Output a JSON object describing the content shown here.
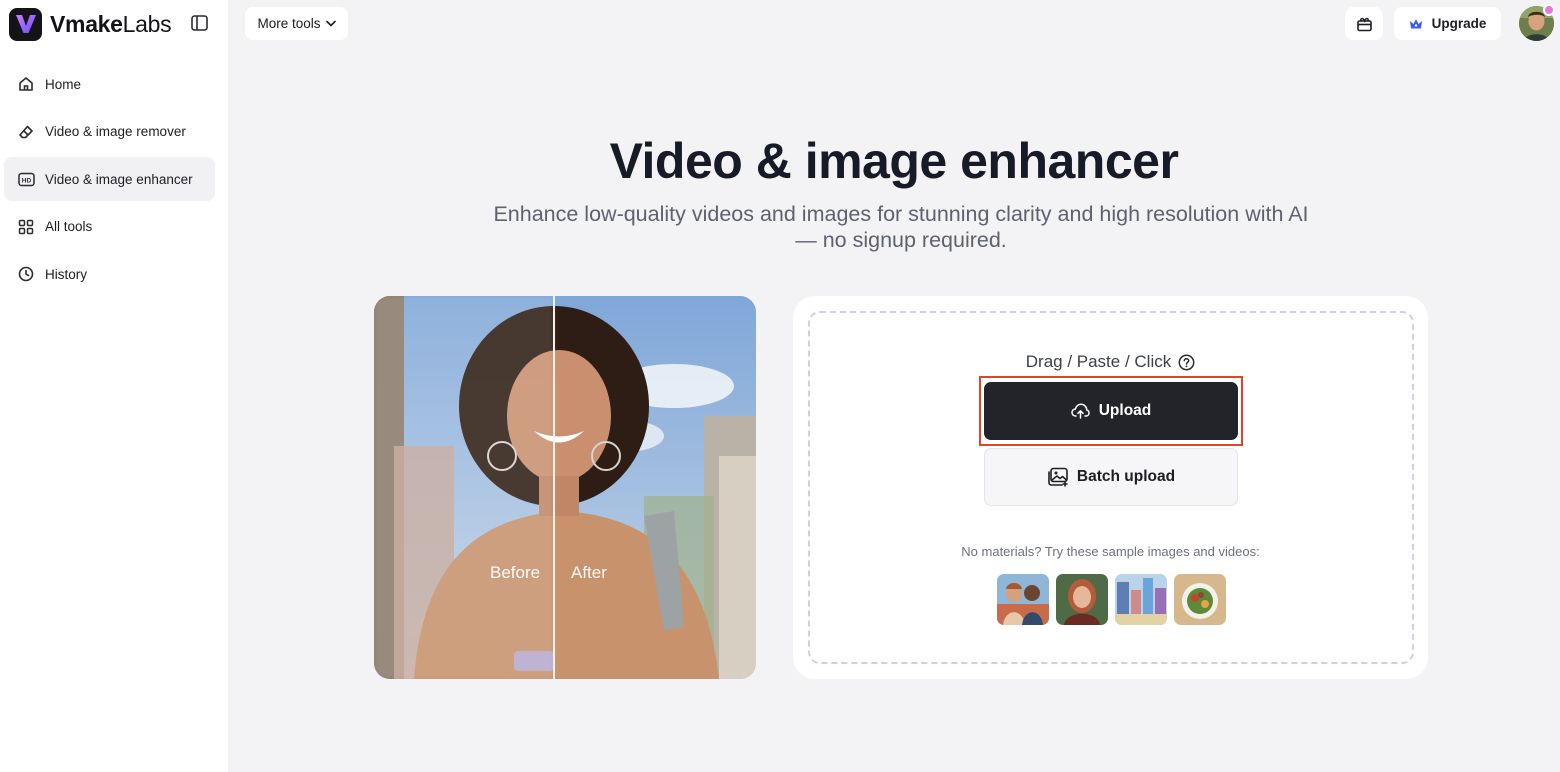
{
  "brand": {
    "name_bold": "Vmake",
    "name_light": "Labs",
    "logo_letter": "V"
  },
  "sidebar": {
    "items": [
      {
        "label": "Home",
        "icon": "home-icon",
        "active": false
      },
      {
        "label": "Video & image remover",
        "icon": "eraser-icon",
        "active": false
      },
      {
        "label": "Video & image enhancer",
        "icon": "hd-icon",
        "active": true
      },
      {
        "label": "All tools",
        "icon": "grid-icon",
        "active": false
      },
      {
        "label": "History",
        "icon": "clock-icon",
        "active": false
      }
    ]
  },
  "topbar": {
    "more_tools_label": "More tools",
    "upgrade_label": "Upgrade"
  },
  "hero": {
    "title": "Video & image enhancer",
    "subtitle": "Enhance low-quality videos and images for stunning clarity and high resolution with AI — no signup required."
  },
  "preview": {
    "before_label": "Before",
    "after_label": "After"
  },
  "upload": {
    "hint": "Drag / Paste / Click",
    "upload_label": "Upload",
    "batch_label": "Batch upload",
    "sample_note": "No materials? Try these sample images and videos:"
  },
  "colors": {
    "accent_dark": "#23242a",
    "highlight": "#e0442f",
    "upgrade_icon": "#3b5cf6",
    "page_bg": "#f3f3f5"
  }
}
